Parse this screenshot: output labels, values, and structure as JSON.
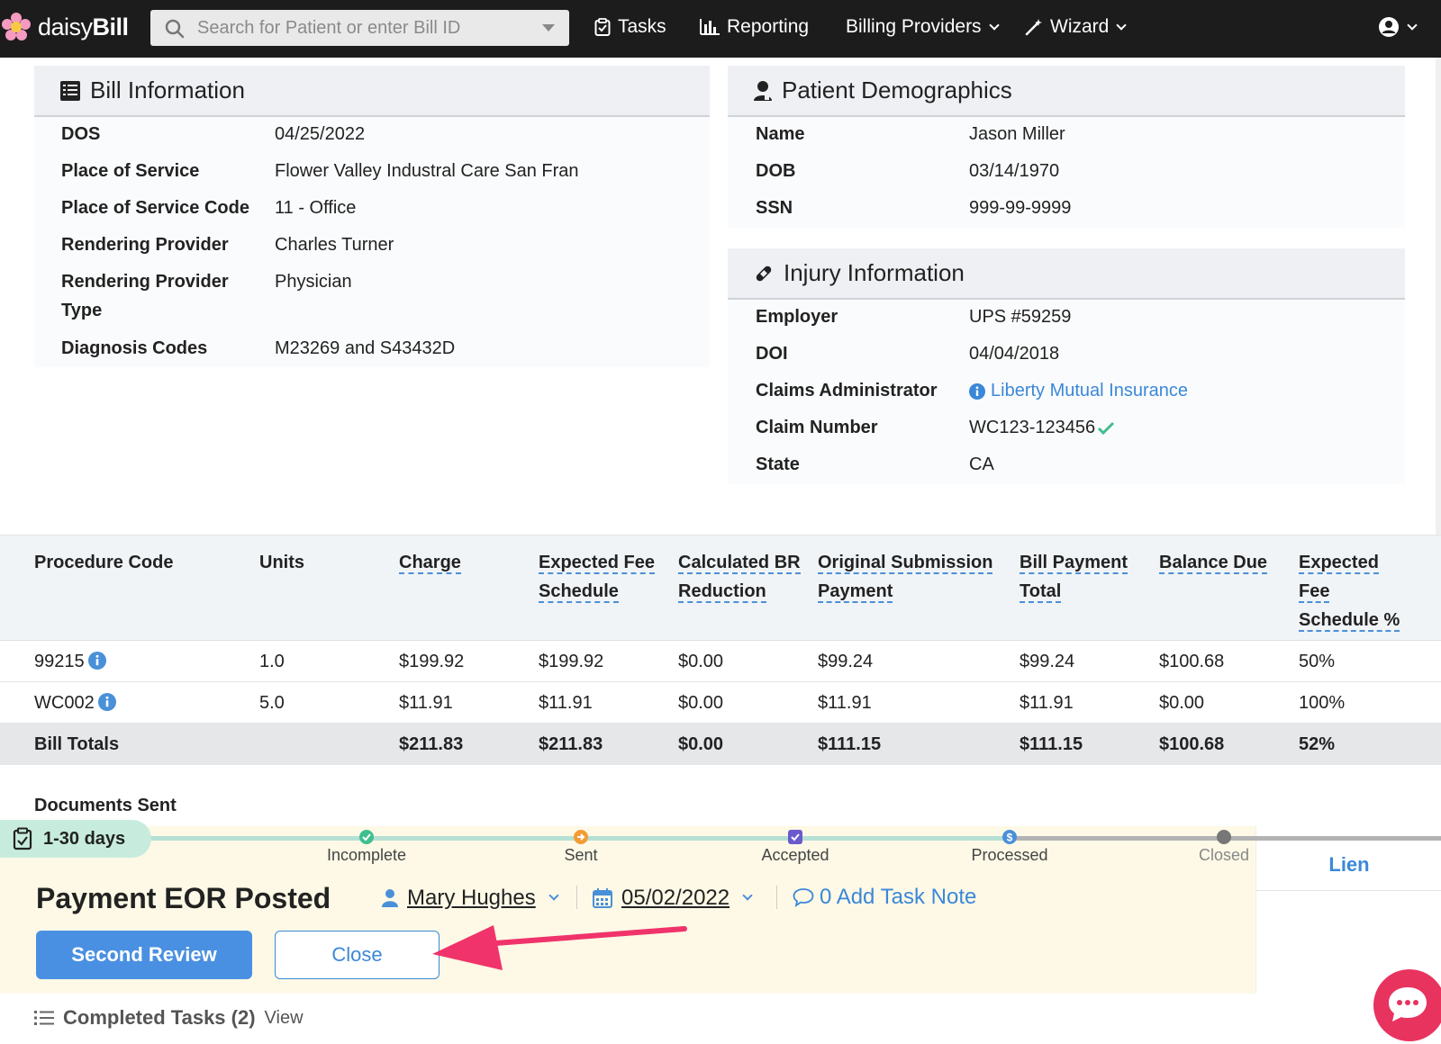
{
  "nav": {
    "brand_light": "daisy",
    "brand_bold": "Bill",
    "search_placeholder": "Search for Patient or enter Bill ID",
    "tasks": "Tasks",
    "reporting": "Reporting",
    "billing_providers": "Billing Providers",
    "wizard": "Wizard"
  },
  "bill_info": {
    "title": "Bill Information",
    "rows": [
      {
        "label": "DOS",
        "value": "04/25/2022"
      },
      {
        "label": "Place of Service",
        "value": "Flower Valley Industral Care San Fran"
      },
      {
        "label": "Place of Service Code",
        "value": "11 - Office"
      },
      {
        "label": "Rendering Provider",
        "value": "Charles Turner"
      },
      {
        "label_line1": "Rendering Provider",
        "label_line2": "Type",
        "value": "Physician"
      },
      {
        "label": "Diagnosis Codes",
        "value": "M23269 and S43432D"
      }
    ]
  },
  "patient_demo": {
    "title": "Patient Demographics",
    "rows": [
      {
        "label": "Name",
        "value": "Jason Miller"
      },
      {
        "label": "DOB",
        "value": "03/14/1970"
      },
      {
        "label": "SSN",
        "value": "999-99-9999"
      }
    ]
  },
  "injury_info": {
    "title": "Injury Information",
    "rows": [
      {
        "label": "Employer",
        "value": "UPS #59259"
      },
      {
        "label": "DOI",
        "value": "04/04/2018"
      },
      {
        "label": "Claims Administrator",
        "value": "Liberty Mutual Insurance"
      },
      {
        "label": "Claim Number",
        "value": "WC123-123456"
      },
      {
        "label": "State",
        "value": "CA"
      }
    ]
  },
  "table": {
    "headers": {
      "procedure_code": "Procedure Code",
      "units": "Units",
      "charge": "Charge",
      "expected_fee_1": "Expected Fee",
      "expected_fee_2": "Schedule",
      "calc_br_1": "Calculated BR",
      "calc_br_2": "Reduction",
      "orig_sub_1": "Original Submission",
      "orig_sub_2": "Payment",
      "bill_payment_1": "Bill Payment",
      "bill_payment_2": "Total",
      "balance_due": "Balance Due",
      "efs_pct_1": "Expected",
      "efs_pct_2": "Fee",
      "efs_pct_3": "Schedule %"
    },
    "rows": [
      {
        "code": "99215",
        "units": "1.0",
        "charge": "$199.92",
        "expected_fee": "$199.92",
        "calc_br": "$0.00",
        "orig_sub": "$99.24",
        "bill_payment": "$99.24",
        "balance_due": "$100.68",
        "efs_pct": "50%"
      },
      {
        "code": "WC002",
        "units": "5.0",
        "charge": "$11.91",
        "expected_fee": "$11.91",
        "calc_br": "$0.00",
        "orig_sub": "$11.91",
        "bill_payment": "$11.91",
        "balance_due": "$0.00",
        "efs_pct": "100%"
      }
    ],
    "totals": {
      "label": "Bill Totals",
      "charge": "$211.83",
      "expected_fee": "$211.83",
      "calc_br": "$0.00",
      "orig_sub": "$111.15",
      "bill_payment": "$111.15",
      "balance_due": "$100.68",
      "efs_pct": "52%"
    }
  },
  "task": {
    "documents_sent": "Documents Sent",
    "days_badge": "1-30 days",
    "steps": [
      "Incomplete",
      "Sent",
      "Accepted",
      "Processed",
      "Closed"
    ],
    "title": "Payment EOR Posted",
    "assignee": "Mary Hughes",
    "due_date": "05/02/2022",
    "task_note": "0 Add Task Note",
    "primary_button": "Second Review",
    "secondary_button": "Close",
    "lien_tab": "Lien",
    "completed_label": "Completed Tasks (2)",
    "completed_view": "View"
  },
  "colors": {
    "accent": "#4a90e2",
    "link": "#3b88d8",
    "arrow": "#f0336b",
    "task_bg": "#fdf9e6",
    "chat": "#e8335f"
  }
}
